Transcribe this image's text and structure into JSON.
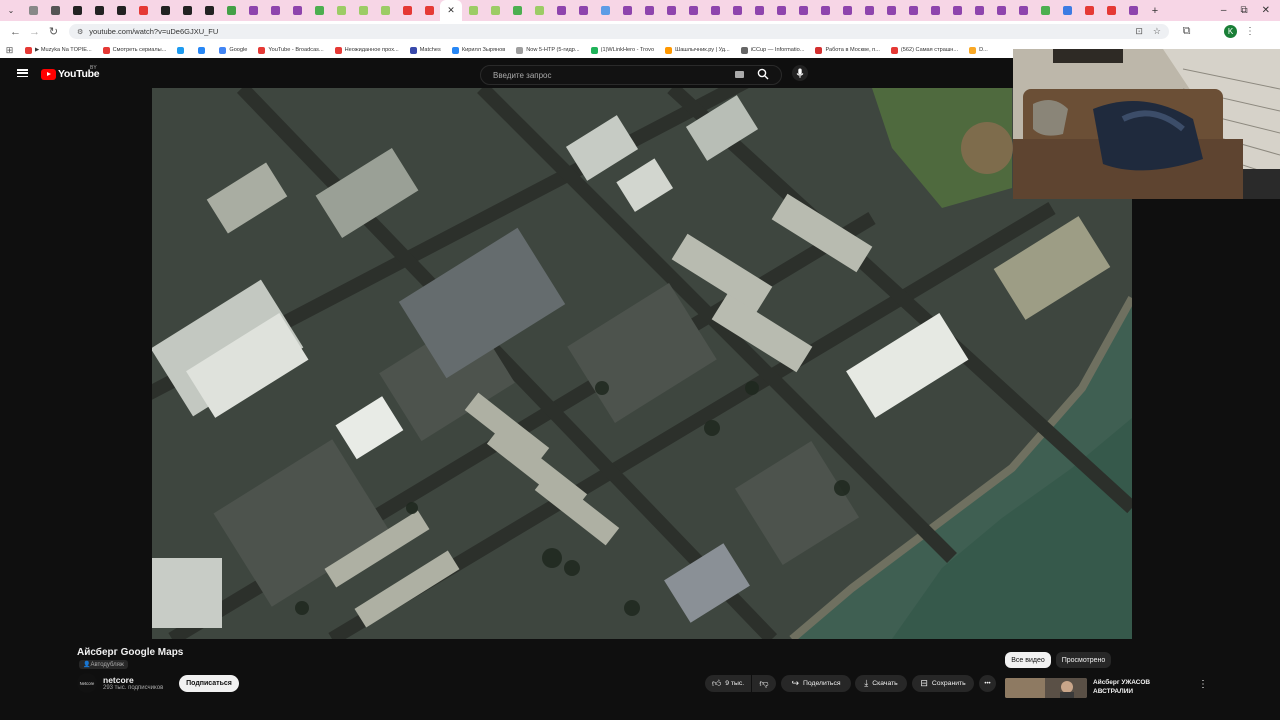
{
  "browser": {
    "tab_favicon_colors": [
      "#888888",
      "#555555",
      "#222222",
      "#222222",
      "#222222",
      "#e53935",
      "#222222",
      "#222222",
      "#222222",
      "#43a047",
      "#8e44ad",
      "#8e44ad",
      "#8e44ad",
      "#4caf50",
      "#9ccc65",
      "#9ccc65",
      "#9ccc65",
      "#e53935",
      "#e53935",
      "#ffffff",
      "#9ccc65",
      "#9ccc65",
      "#4caf50",
      "#9ccc65",
      "#8e44ad",
      "#8e44ad",
      "#5c9ce6",
      "#8e44ad",
      "#8e44ad",
      "#8e44ad",
      "#8e44ad",
      "#8e44ad",
      "#8e44ad",
      "#8e44ad",
      "#8e44ad",
      "#8e44ad",
      "#8e44ad",
      "#8e44ad",
      "#8e44ad",
      "#8e44ad",
      "#8e44ad",
      "#8e44ad",
      "#8e44ad",
      "#8e44ad",
      "#8e44ad",
      "#8e44ad",
      "#4caf50",
      "#3d7be3",
      "#e53935",
      "#e53935",
      "#8e44ad"
    ],
    "active_tab_index": 19,
    "active_tab_close": "✕",
    "new_tab": "+",
    "window_controls": {
      "minimize": "–",
      "restore": "⧉",
      "close": "✕"
    },
    "url": "youtube.com/watch?v=uDe6GJXU_FU",
    "profile_initial": "K",
    "bookmarks": [
      {
        "label": "▶ Muzyka Na TOPIE...",
        "color": "#e53935"
      },
      {
        "label": "Смотреть сериалы...",
        "color": "#e53935"
      },
      {
        "label": "",
        "color": "#1d9bf0"
      },
      {
        "label": "",
        "color": "#2787f5"
      },
      {
        "label": "Google",
        "color": "#4285f4"
      },
      {
        "label": "YouTube - Broadcas...",
        "color": "#e53935"
      },
      {
        "label": "Неожиданное прох...",
        "color": "#e53935"
      },
      {
        "label": "Matches",
        "color": "#3949ab"
      },
      {
        "label": "Кирилл Зырянов",
        "color": "#2787f5"
      },
      {
        "label": "Now 5-HTP (5-гидр...",
        "color": "#9e9e9e"
      },
      {
        "label": "(1)WLinkHero - Trovo",
        "color": "#20b35a"
      },
      {
        "label": "Шашлычник.ру | Уд...",
        "color": "#ff9800"
      },
      {
        "label": "iCCup — Informatio...",
        "color": "#666666"
      },
      {
        "label": "Работа в Москве, п...",
        "color": "#d32f2f"
      },
      {
        "label": "(562) Самая страшн...",
        "color": "#e53935"
      },
      {
        "label": "D...",
        "color": "#f9a825"
      }
    ]
  },
  "youtube": {
    "logo_text": "YouTube",
    "country_code": "BY",
    "search_placeholder": "Введите запрос",
    "video": {
      "title": "Айсберг Google Maps",
      "dub_badge": "Автодубляж",
      "channel_name": "netcore",
      "channel_avatar_text": "Netcore",
      "subscribers": "293 тыс. подписчиков",
      "subscribe_label": "Подписаться",
      "likes": "9 тыс.",
      "share_label": "Поделиться",
      "download_label": "Скачать",
      "save_label": "Сохранить",
      "more_label": "•••"
    },
    "chips": {
      "all_label": "Все видео",
      "viewed_label": "Просмотрено"
    },
    "recommendation": {
      "title": "Айсберг УЖАСОВ АВСТРАЛИИ",
      "more": "⋮"
    }
  }
}
